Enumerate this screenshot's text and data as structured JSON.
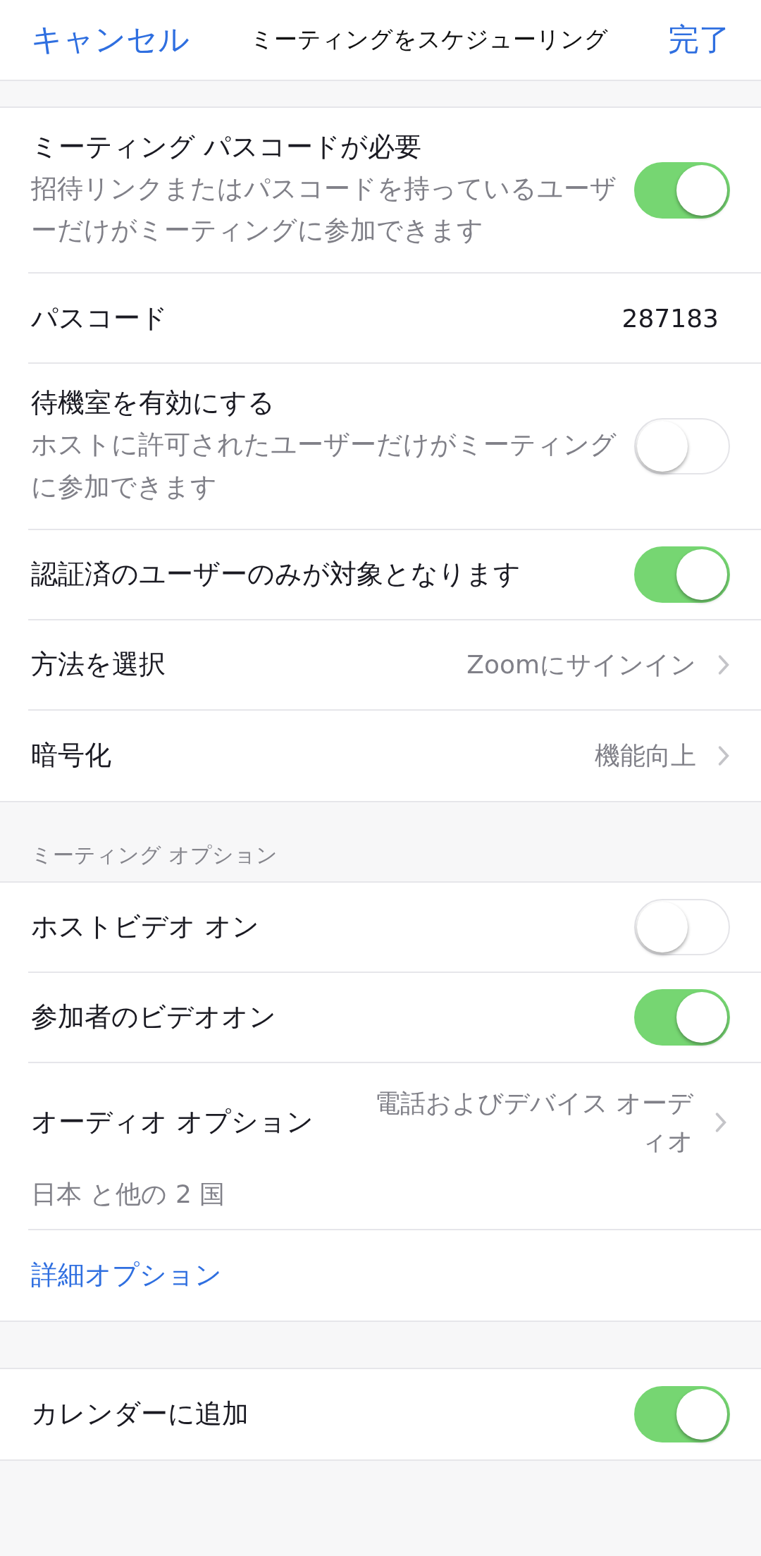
{
  "nav": {
    "cancel": "キャンセル",
    "title": "ミーティングをスケジューリング",
    "done": "完了"
  },
  "sections": [
    {
      "rows": [
        {
          "kind": "toggle",
          "title": "ミーティング パスコードが必要",
          "description": "招待リンクまたはパスコードを持っているユーザーだけがミーティングに参加できます",
          "on": true
        },
        {
          "kind": "value",
          "title": "パスコード",
          "value": "287183"
        },
        {
          "kind": "toggle",
          "title": "待機室を有効にする",
          "description": "ホストに許可されたユーザーだけがミーティングに参加できます",
          "on": false
        },
        {
          "kind": "toggle",
          "title": "認証済のユーザーのみが対象となります",
          "on": true
        },
        {
          "kind": "select",
          "title": "方法を選択",
          "value": "Zoomにサインイン"
        },
        {
          "kind": "select",
          "title": "暗号化",
          "value": "機能向上"
        }
      ]
    },
    {
      "label": "ミーティング オプション",
      "rows": [
        {
          "kind": "toggle",
          "title": "ホストビデオ オン",
          "on": false
        },
        {
          "kind": "toggle",
          "title": "参加者のビデオオン",
          "on": true
        },
        {
          "kind": "select",
          "title": "オーディオ オプション",
          "value": "電話およびデバイス オーディオ",
          "note": "日本 と他の 2 国"
        },
        {
          "kind": "link",
          "title": "詳細オプション"
        }
      ]
    },
    {
      "rows": [
        {
          "kind": "toggle",
          "title": "カレンダーに追加",
          "on": true
        }
      ]
    }
  ]
}
